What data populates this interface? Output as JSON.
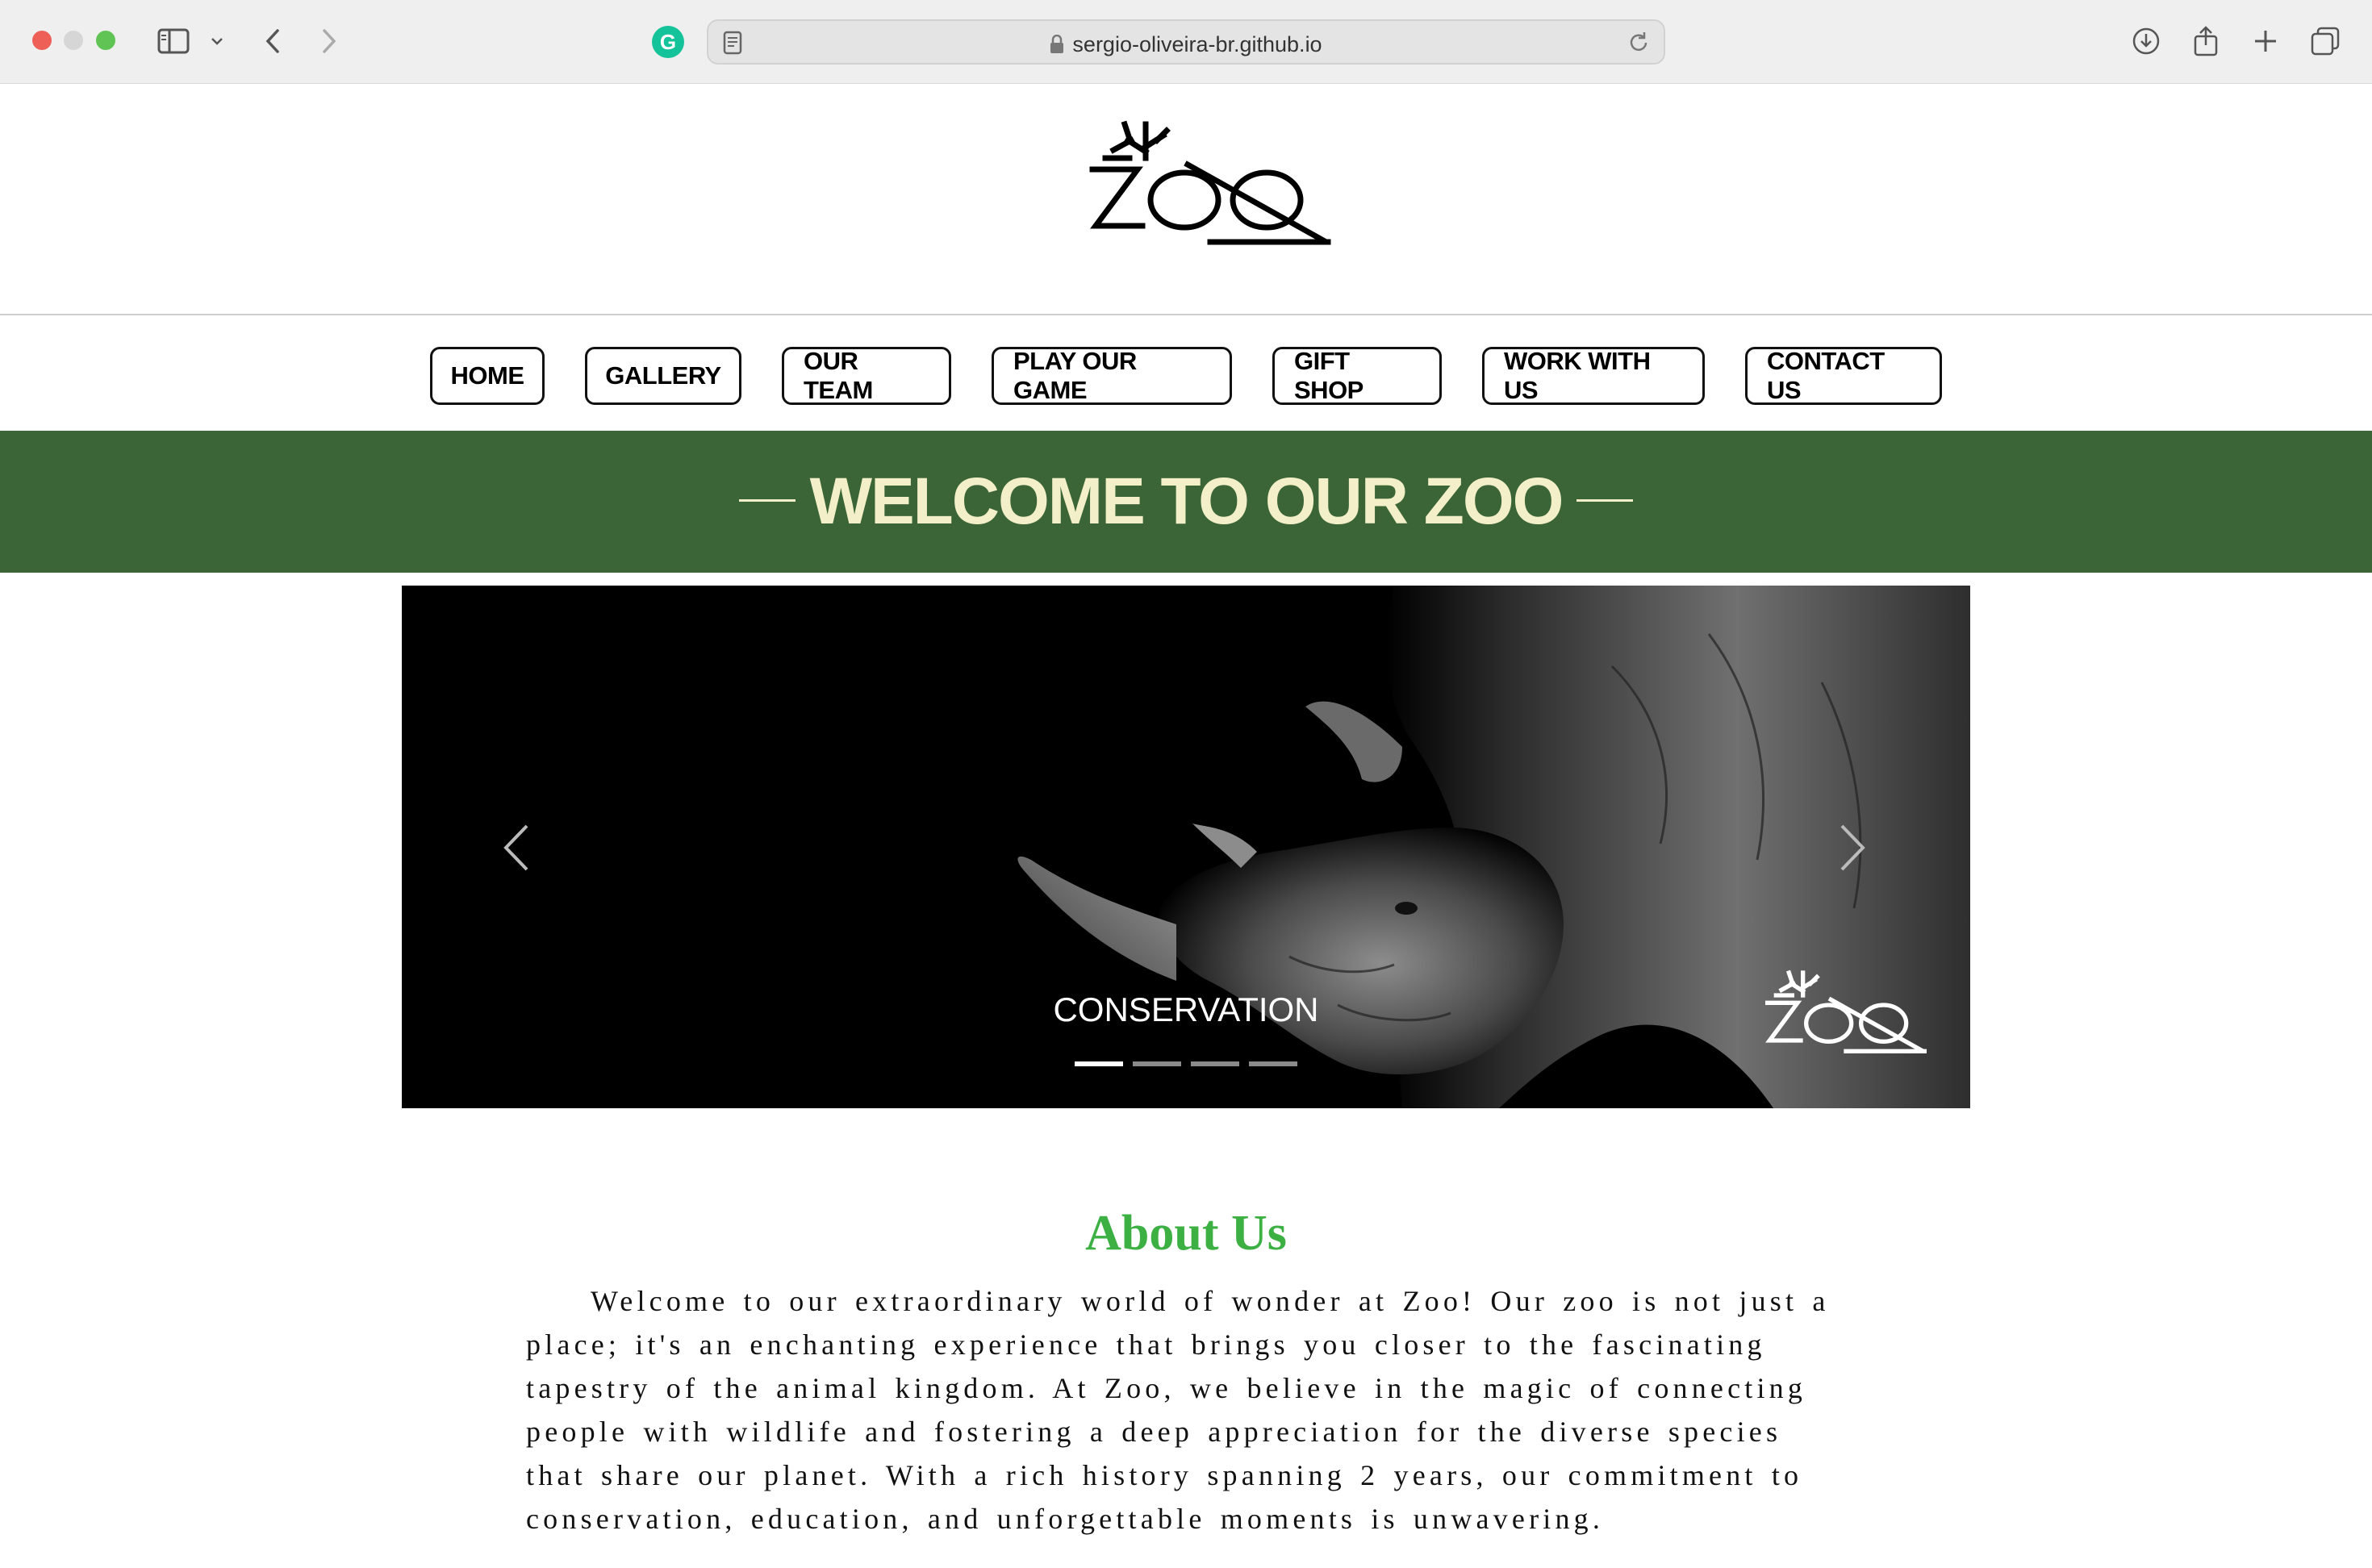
{
  "browser": {
    "url": "sergio-oliveira-br.github.io",
    "extension_icon": "G"
  },
  "header": {
    "logo_text": "ZOO"
  },
  "nav": {
    "items": [
      {
        "label": "HOME"
      },
      {
        "label": "GALLERY"
      },
      {
        "label": "OUR TEAM"
      },
      {
        "label": "PLAY OUR GAME"
      },
      {
        "label": "GIFT SHOP"
      },
      {
        "label": "WORK WITH US"
      },
      {
        "label": "CONTACT US"
      }
    ]
  },
  "banner": {
    "title": "WELCOME TO OUR ZOO"
  },
  "carousel": {
    "caption": "CONSERVATION",
    "slide_count": 4,
    "active_slide": 1,
    "logo_text": "ZOO"
  },
  "about": {
    "title": "About Us",
    "text": "Welcome to our extraordinary world of wonder at Zoo! Our zoo is not just a place; it's an enchanting experience that brings you closer to the fascinating tapestry of the animal kingdom. At Zoo, we believe in the magic of connecting people with wildlife and fostering a deep appreciation for the diverse species that share our planet. With a rich history spanning 2 years, our commitment to conservation, education, and unforgettable moments is unwavering."
  },
  "colors": {
    "banner_bg": "#3b6536",
    "banner_text": "#f3f0c9",
    "about_title": "#3cb043"
  }
}
